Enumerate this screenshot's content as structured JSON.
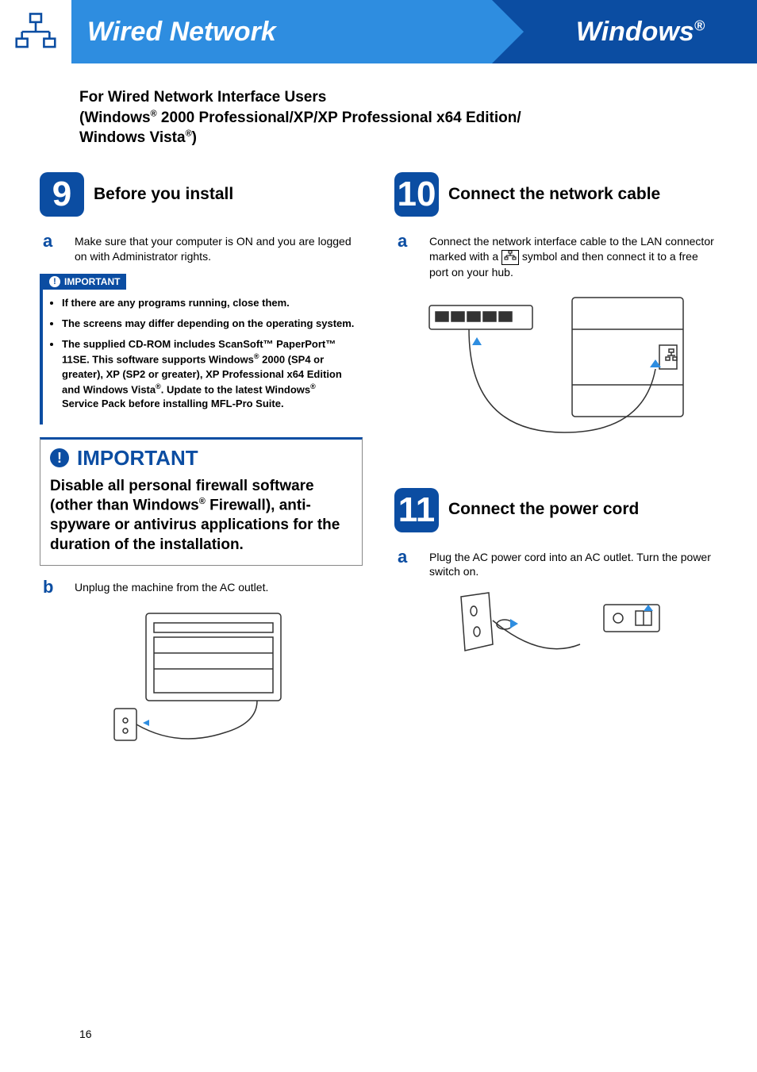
{
  "header": {
    "left": "Wired Network",
    "right": "Windows",
    "right_sup": "®"
  },
  "intro": {
    "line1": "For Wired Network Interface Users",
    "line2a": "(Windows",
    "line2a_sup": "®",
    "line2b": " 2000 Professional/XP/XP Professional x64 Edition/",
    "line3a": "Windows Vista",
    "line3a_sup": "®",
    "line3b": ")"
  },
  "step9": {
    "num": "9",
    "title": "Before you install",
    "a_letter": "a",
    "a_text": "Make sure that your computer is ON and you are logged on with Administrator rights.",
    "imp_label": "IMPORTANT",
    "b1": "If there are any programs running, close them.",
    "b2": "The screens may differ depending on the operating system.",
    "b3a": "The supplied CD-ROM includes ScanSoft™ PaperPort™ 11SE. This software supports Windows",
    "b3a_sup": "®",
    "b3b": " 2000 (SP4 or greater), XP (SP2 or greater), XP Professional x64 Edition and Windows Vista",
    "b3b_sup": "®",
    "b3c": ". Update to the latest Windows",
    "b3c_sup": "®",
    "b3d": " Service Pack before installing MFL-Pro Suite."
  },
  "imp_large": {
    "label": "IMPORTANT",
    "body_a": "Disable all personal firewall software (other than Windows",
    "body_sup": "®",
    "body_b": " Firewall), anti-spyware or antivirus applications for the duration of the installation."
  },
  "step9b": {
    "letter": "b",
    "text": "Unplug the machine from the AC outlet."
  },
  "step10": {
    "num": "10",
    "title": "Connect the network cable",
    "a_letter": "a",
    "a_text_before": "Connect the network interface cable to the LAN connector marked with a ",
    "a_text_after": " symbol and then connect it to a free port on your hub."
  },
  "step11": {
    "num": "11",
    "title": "Connect the power cord",
    "a_letter": "a",
    "a_text": "Plug the AC power cord into an AC outlet. Turn the power switch on."
  },
  "page_number": "16"
}
